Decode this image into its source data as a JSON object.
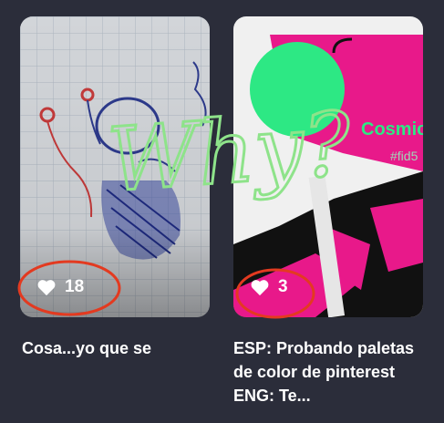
{
  "posts": [
    {
      "likes": "18",
      "title": "Cosa...yo que se"
    },
    {
      "likes": "3",
      "title": "ESP: Probando paletas de color de pinterest ENG: Te..."
    }
  ],
  "thumb_right_text": {
    "line1": "Cosmic",
    "line2": "#fid5"
  },
  "annotation_text": "Why?",
  "colors": {
    "background": "#2b2d3a",
    "annotation_circle": "#e33a20",
    "annotation_text": "#8ee38a",
    "pink": "#e8198a",
    "green": "#2de884"
  }
}
